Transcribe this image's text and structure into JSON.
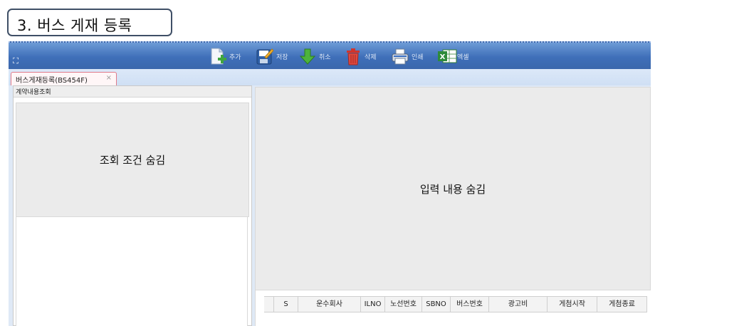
{
  "section_title": "3. 버스 게재 등록",
  "toolbar": {
    "expand_icon": "expand-icon",
    "buttons": [
      {
        "label": "추가",
        "icon": "add-document-icon"
      },
      {
        "label": "저장",
        "icon": "save-icon"
      },
      {
        "label": "취소",
        "icon": "cancel-arrow-icon"
      },
      {
        "label": "삭제",
        "icon": "trash-icon"
      },
      {
        "label": "인쇄",
        "icon": "printer-icon"
      },
      {
        "label": "엑셀",
        "icon": "excel-icon"
      }
    ]
  },
  "tab": {
    "label": "버스게재등록(BS454F)",
    "close": "×"
  },
  "left_panel": {
    "header": "계약내용조회",
    "hidden_text": "조회 조건 숨김"
  },
  "right_panel": {
    "hidden_text": "입력 내용 숨김"
  },
  "grid": {
    "columns": [
      "",
      "S",
      "운수회사",
      "ILNO",
      "노선번호",
      "SBNO",
      "버스번호",
      "광고비",
      "게첨시작",
      "게첨종료"
    ]
  },
  "colors": {
    "toolbar_top": "#6d9bd6",
    "toolbar_bottom": "#3b67ac",
    "tab_border": "#e07a8a",
    "panel_gray": "#ebebeb",
    "title_border": "#3f4f66"
  }
}
